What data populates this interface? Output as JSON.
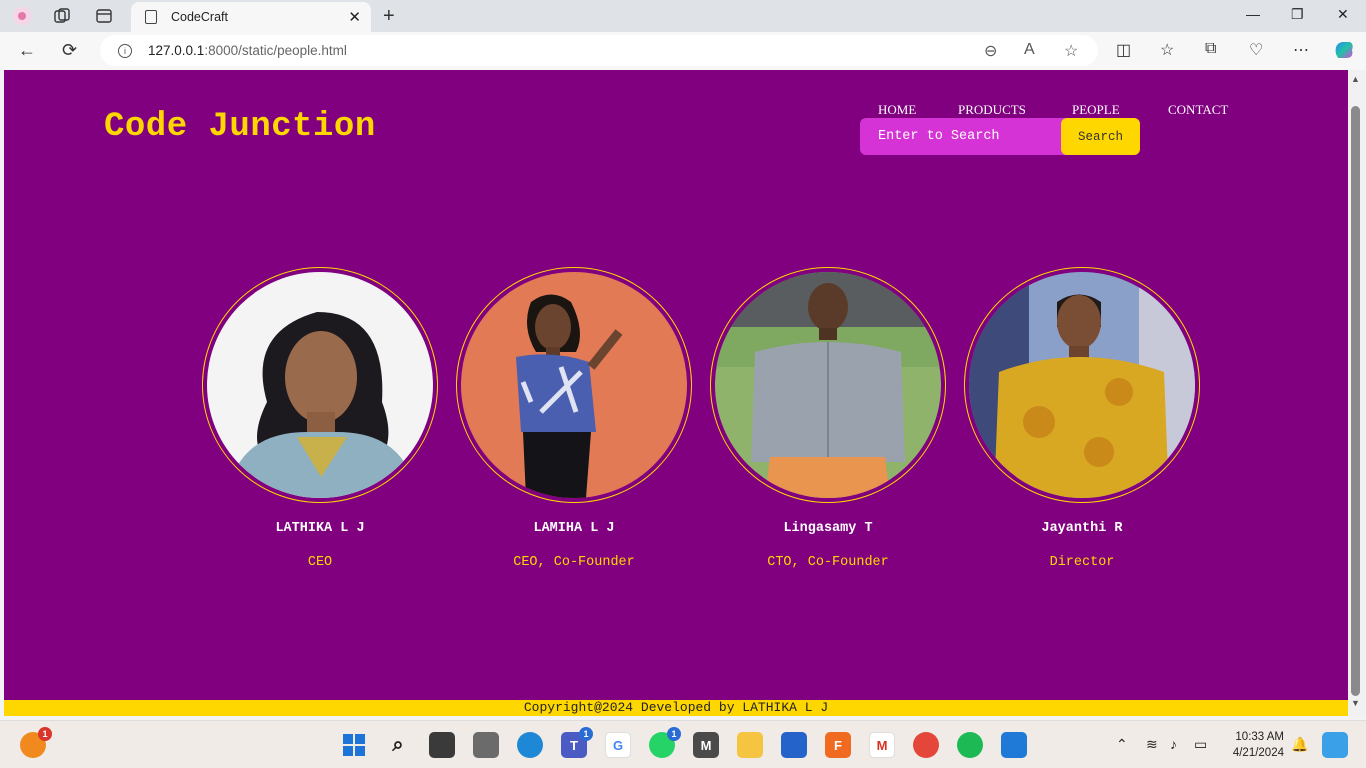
{
  "browser": {
    "tab_title": "CodeCraft",
    "url_host": "127.0.0.1",
    "url_rest": ":8000/static/people.html"
  },
  "site": {
    "brand": "Code Junction",
    "nav": [
      "HOME",
      "PRODUCTS",
      "PEOPLE",
      "CONTACT"
    ],
    "search_placeholder": "Enter to Search",
    "search_button": "Search",
    "people": [
      {
        "name": "LATHIKA L J",
        "role": "CEO"
      },
      {
        "name": "LAMIHA L J",
        "role": "CEO, Co-Founder"
      },
      {
        "name": "Lingasamy T",
        "role": "CTO, Co-Founder"
      },
      {
        "name": "Jayanthi R",
        "role": "Director"
      }
    ],
    "footer": "Copyright@2024 Developed by LATHIKA L J"
  },
  "taskbar": {
    "time": "10:33 AM",
    "date": "4/21/2024",
    "badges": {
      "weather": "1",
      "teams": "1",
      "whatsapp": "1"
    }
  },
  "colors": {
    "page_bg": "#800080",
    "accent": "#ffd700",
    "search_bg": "#d633d6"
  }
}
